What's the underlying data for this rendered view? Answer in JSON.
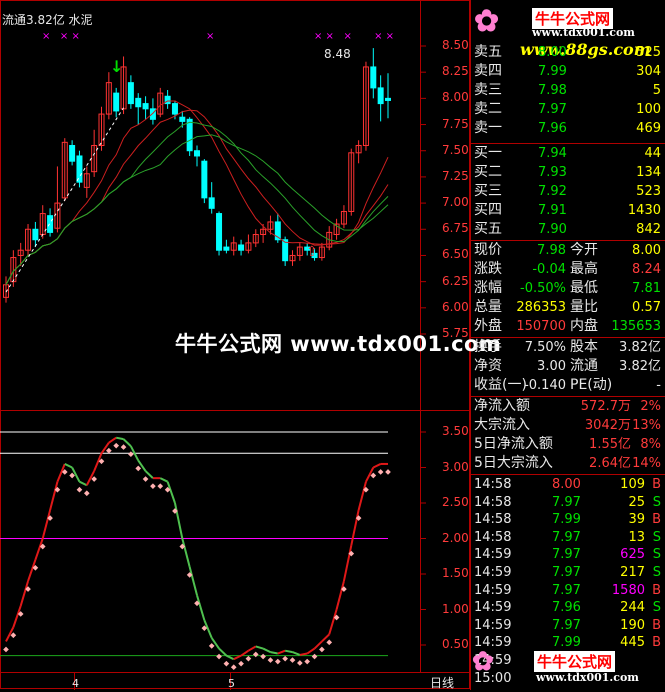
{
  "header": {
    "label": "流通3.82亿 水泥",
    "arrow": "↓",
    "peak_label": "8.48"
  },
  "banner": "牛牛公式网 www.tdx001.com",
  "logo": {
    "title": "牛牛公式网",
    "url1": "www.tdx001.com",
    "url2": "www.88gs.com"
  },
  "price_axis": [
    "8.50",
    "8.25",
    "8.00",
    "7.75",
    "7.50",
    "7.25",
    "7.00",
    "6.75",
    "6.50",
    "6.25",
    "6.00",
    "5.75"
  ],
  "ind_axis": [
    "3.50",
    "3.00",
    "2.50",
    "2.00",
    "1.50",
    "1.00",
    "0.50"
  ],
  "bottom_axis": {
    "ticks": [
      "4",
      "5"
    ],
    "period": "日线"
  },
  "order_book": {
    "asks": [
      {
        "label": "卖五",
        "price": "8.00",
        "vol": "525"
      },
      {
        "label": "卖四",
        "price": "7.99",
        "vol": "304"
      },
      {
        "label": "卖三",
        "price": "7.98",
        "vol": "5"
      },
      {
        "label": "卖二",
        "price": "7.97",
        "vol": "100"
      },
      {
        "label": "卖一",
        "price": "7.96",
        "vol": "469"
      }
    ],
    "bids": [
      {
        "label": "买一",
        "price": "7.94",
        "vol": "44"
      },
      {
        "label": "买二",
        "price": "7.93",
        "vol": "134"
      },
      {
        "label": "买三",
        "price": "7.92",
        "vol": "523"
      },
      {
        "label": "买四",
        "price": "7.91",
        "vol": "1430"
      },
      {
        "label": "买五",
        "price": "7.90",
        "vol": "842"
      }
    ]
  },
  "quote": [
    {
      "l1": "现价",
      "v1": "7.98",
      "l2": "今开",
      "v2": "8.00",
      "c1": "g",
      "c2": "y"
    },
    {
      "l1": "涨跌",
      "v1": "-0.04",
      "l2": "最高",
      "v2": "8.24",
      "c1": "g",
      "c2": "r"
    },
    {
      "l1": "涨幅",
      "v1": "-0.50%",
      "l2": "最低",
      "v2": "7.81",
      "c1": "g",
      "c2": "g"
    },
    {
      "l1": "总量",
      "v1": "286353",
      "l2": "量比",
      "v2": "0.57",
      "c1": "y",
      "c2": "y"
    },
    {
      "l1": "外盘",
      "v1": "150700",
      "l2": "内盘",
      "v2": "135653",
      "c1": "r",
      "c2": "g"
    }
  ],
  "fund": [
    {
      "l1": "换手",
      "v1": "7.50%",
      "l2": "股本",
      "v2": "3.82亿"
    },
    {
      "l1": "净资",
      "v1": "3.00",
      "l2": "流通",
      "v2": "3.82亿"
    },
    {
      "l1": "收益(一)",
      "v1": "-0.140",
      "l2": "PE(动)",
      "v2": "-"
    }
  ],
  "flow": [
    {
      "label": "净流入额",
      "value": "572.7万",
      "pct": "2%"
    },
    {
      "label": "大宗流入",
      "value": "3042万",
      "pct": "13%"
    },
    {
      "label": "5日净流入额",
      "value": "1.55亿",
      "pct": "8%"
    },
    {
      "label": "5日大宗流入",
      "value": "2.64亿",
      "pct": "14%"
    }
  ],
  "ticks": [
    {
      "time": "14:58",
      "price": "8.00",
      "vol": "109",
      "side": "B",
      "pc": "r",
      "vc": "y"
    },
    {
      "time": "14:58",
      "price": "7.97",
      "vol": "25",
      "side": "S",
      "pc": "g",
      "vc": "y"
    },
    {
      "time": "14:58",
      "price": "7.99",
      "vol": "39",
      "side": "B",
      "pc": "g",
      "vc": "y"
    },
    {
      "time": "14:58",
      "price": "7.97",
      "vol": "13",
      "side": "S",
      "pc": "g",
      "vc": "y"
    },
    {
      "time": "14:59",
      "price": "7.97",
      "vol": "625",
      "side": "S",
      "pc": "g",
      "vc": "m"
    },
    {
      "time": "14:59",
      "price": "7.97",
      "vol": "217",
      "side": "S",
      "pc": "g",
      "vc": "y"
    },
    {
      "time": "14:59",
      "price": "7.97",
      "vol": "1580",
      "side": "B",
      "pc": "g",
      "vc": "m"
    },
    {
      "time": "14:59",
      "price": "7.96",
      "vol": "244",
      "side": "S",
      "pc": "g",
      "vc": "y"
    },
    {
      "time": "14:59",
      "price": "7.97",
      "vol": "190",
      "side": "B",
      "pc": "g",
      "vc": "y"
    },
    {
      "time": "14:59",
      "price": "7.99",
      "vol": "445",
      "side": "B",
      "pc": "g",
      "vc": "y"
    },
    {
      "time": "14:59",
      "price": "",
      "vol": "",
      "side": "",
      "pc": "g",
      "vc": "y"
    },
    {
      "time": "15:00",
      "price": "",
      "vol": "",
      "side": "",
      "pc": "g",
      "vc": "y"
    }
  ],
  "colors": {
    "up": "#ff3333",
    "down": "#00ffff",
    "ma_red": "#cc1f1f",
    "ma_green": "#2aa12a",
    "magenta": "#ff00ff",
    "grid": "#b00000"
  },
  "chart_data": {
    "type": "candlestick",
    "candles": [
      {
        "o": 6.1,
        "c": 6.22,
        "h": 6.3,
        "l": 6.05
      },
      {
        "o": 6.25,
        "c": 6.48,
        "h": 6.55,
        "l": 6.2
      },
      {
        "o": 6.5,
        "c": 6.55,
        "h": 6.62,
        "l": 6.4
      },
      {
        "o": 6.55,
        "c": 6.75,
        "h": 6.8,
        "l": 6.5
      },
      {
        "o": 6.75,
        "c": 6.65,
        "h": 6.82,
        "l": 6.58
      },
      {
        "o": 6.7,
        "c": 6.9,
        "h": 6.98,
        "l": 6.66
      },
      {
        "o": 6.88,
        "c": 6.72,
        "h": 6.95,
        "l": 6.68
      },
      {
        "o": 6.76,
        "c": 7.0,
        "h": 7.35,
        "l": 6.72
      },
      {
        "o": 7.05,
        "c": 7.58,
        "h": 7.62,
        "l": 7.02
      },
      {
        "o": 7.55,
        "c": 7.4,
        "h": 7.6,
        "l": 7.36
      },
      {
        "o": 7.45,
        "c": 7.2,
        "h": 7.5,
        "l": 7.15
      },
      {
        "o": 7.15,
        "c": 7.28,
        "h": 7.35,
        "l": 7.05
      },
      {
        "o": 7.3,
        "c": 7.55,
        "h": 7.7,
        "l": 7.25
      },
      {
        "o": 7.55,
        "c": 7.85,
        "h": 7.92,
        "l": 7.5
      },
      {
        "o": 7.85,
        "c": 8.15,
        "h": 8.25,
        "l": 7.8
      },
      {
        "o": 8.05,
        "c": 7.88,
        "h": 8.1,
        "l": 7.82
      },
      {
        "o": 7.9,
        "c": 8.3,
        "h": 8.4,
        "l": 7.85
      },
      {
        "o": 8.15,
        "c": 7.95,
        "h": 8.22,
        "l": 7.9
      },
      {
        "o": 8.0,
        "c": 7.92,
        "h": 8.05,
        "l": 7.75
      },
      {
        "o": 7.95,
        "c": 7.9,
        "h": 8.02,
        "l": 7.8
      },
      {
        "o": 7.9,
        "c": 7.8,
        "h": 8.0,
        "l": 7.75
      },
      {
        "o": 7.85,
        "c": 8.05,
        "h": 8.1,
        "l": 7.82
      },
      {
        "o": 8.02,
        "c": 7.95,
        "h": 8.08,
        "l": 7.9
      },
      {
        "o": 7.95,
        "c": 7.85,
        "h": 7.98,
        "l": 7.8
      },
      {
        "o": 7.82,
        "c": 7.78,
        "h": 7.88,
        "l": 7.72
      },
      {
        "o": 7.8,
        "c": 7.5,
        "h": 7.82,
        "l": 7.45
      },
      {
        "o": 7.5,
        "c": 7.45,
        "h": 7.55,
        "l": 7.35
      },
      {
        "o": 7.4,
        "c": 7.05,
        "h": 7.42,
        "l": 7.0
      },
      {
        "o": 7.05,
        "c": 6.95,
        "h": 7.2,
        "l": 6.9
      },
      {
        "o": 6.9,
        "c": 6.55,
        "h": 6.92,
        "l": 6.5
      },
      {
        "o": 6.58,
        "c": 6.55,
        "h": 6.65,
        "l": 6.52
      },
      {
        "o": 6.55,
        "c": 6.62,
        "h": 6.68,
        "l": 6.5
      },
      {
        "o": 6.6,
        "c": 6.55,
        "h": 6.65,
        "l": 6.5
      },
      {
        "o": 6.55,
        "c": 6.62,
        "h": 6.7,
        "l": 6.52
      },
      {
        "o": 6.62,
        "c": 6.7,
        "h": 6.75,
        "l": 6.58
      },
      {
        "o": 6.7,
        "c": 6.75,
        "h": 6.8,
        "l": 6.62
      },
      {
        "o": 6.75,
        "c": 6.82,
        "h": 6.88,
        "l": 6.7
      },
      {
        "o": 6.82,
        "c": 6.65,
        "h": 6.9,
        "l": 6.62
      },
      {
        "o": 6.65,
        "c": 6.45,
        "h": 6.68,
        "l": 6.4
      },
      {
        "o": 6.45,
        "c": 6.5,
        "h": 6.55,
        "l": 6.4
      },
      {
        "o": 6.5,
        "c": 6.58,
        "h": 6.62,
        "l": 6.45
      },
      {
        "o": 6.58,
        "c": 6.55,
        "h": 6.62,
        "l": 6.5
      },
      {
        "o": 6.52,
        "c": 6.48,
        "h": 6.56,
        "l": 6.45
      },
      {
        "o": 6.48,
        "c": 6.58,
        "h": 6.62,
        "l": 6.45
      },
      {
        "o": 6.58,
        "c": 6.72,
        "h": 6.78,
        "l": 6.55
      },
      {
        "o": 6.7,
        "c": 6.8,
        "h": 6.85,
        "l": 6.65
      },
      {
        "o": 6.8,
        "c": 6.92,
        "h": 6.98,
        "l": 6.76
      },
      {
        "o": 6.92,
        "c": 7.48,
        "h": 7.52,
        "l": 6.88
      },
      {
        "o": 7.48,
        "c": 7.55,
        "h": 7.6,
        "l": 7.38
      },
      {
        "o": 7.55,
        "c": 8.3,
        "h": 8.35,
        "l": 7.5
      },
      {
        "o": 8.3,
        "c": 8.1,
        "h": 8.48,
        "l": 8.0
      },
      {
        "o": 8.1,
        "c": 7.95,
        "h": 8.22,
        "l": 7.78
      },
      {
        "o": 8.0,
        "c": 7.98,
        "h": 8.24,
        "l": 7.81
      }
    ],
    "indicator": [
      0.55,
      0.75,
      1.05,
      1.4,
      1.7,
      2.0,
      2.4,
      2.8,
      3.05,
      3.0,
      2.8,
      2.75,
      2.95,
      3.2,
      3.35,
      3.42,
      3.4,
      3.3,
      3.1,
      2.95,
      2.85,
      2.85,
      2.8,
      2.5,
      2.0,
      1.6,
      1.2,
      0.85,
      0.6,
      0.45,
      0.35,
      0.3,
      0.35,
      0.42,
      0.48,
      0.45,
      0.4,
      0.38,
      0.42,
      0.4,
      0.36,
      0.38,
      0.45,
      0.55,
      0.65,
      1.0,
      1.4,
      1.9,
      2.4,
      2.8,
      3.0,
      3.05,
      3.05
    ],
    "ref_lines": [
      3.5,
      3.2,
      2.0,
      0.35
    ]
  }
}
